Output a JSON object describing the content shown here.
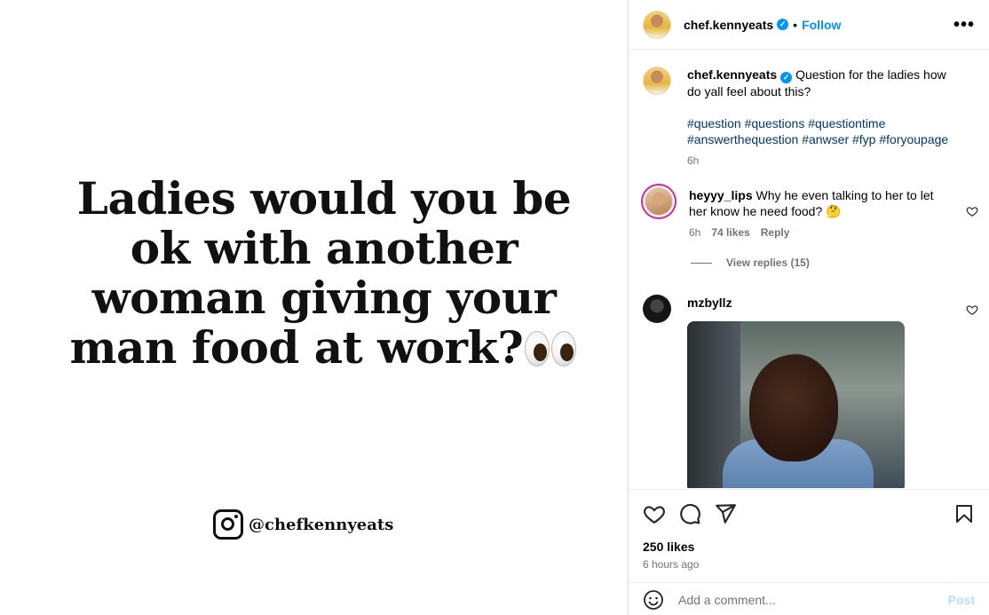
{
  "media": {
    "headline": "Ladies would you be ok with another woman giving your man food at work?",
    "watermark_handle": "@chefkennyeats"
  },
  "header": {
    "username": "chef.kennyeats",
    "separator": "•",
    "follow_label": "Follow",
    "more_label": "•••"
  },
  "caption": {
    "username": "chef.kennyeats",
    "text": "Question for the ladies how do yall feel about this?",
    "hashtags": "#question #questions #questiontime #answerthequestion #anwser #fyp #foryoupage",
    "time": "6h"
  },
  "comments": [
    {
      "username": "heyyy_lips",
      "text": "Why he even talking to her to let her know he need food? 🤔",
      "time": "6h",
      "likes": "74 likes",
      "reply_label": "Reply",
      "view_replies": "View replies (15)"
    },
    {
      "username": "mzbyllz",
      "text": ""
    }
  ],
  "footer": {
    "likes": "250 likes",
    "time_ago": "6 hours ago",
    "comment_placeholder": "Add a comment...",
    "post_label": "Post"
  },
  "colors": {
    "link_blue": "#0095f6",
    "hashtag_blue": "#00376b",
    "muted_gray": "#737373"
  }
}
